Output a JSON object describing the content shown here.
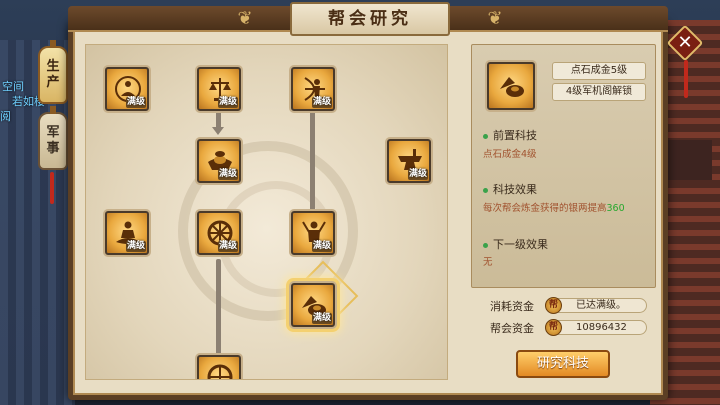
{
  "window": {
    "title": "帮会研究",
    "close_label": "✕"
  },
  "side_tabs": [
    {
      "label_top": "生",
      "label_bottom": "产"
    },
    {
      "label_top": "军",
      "label_bottom": "事"
    }
  ],
  "background_text": [
    "空间",
    "若如楼",
    "阅"
  ],
  "tree": {
    "nodes": [
      {
        "icon": "meditate-icon",
        "tag": "满级"
      },
      {
        "icon": "scale-icon",
        "tag": "满级"
      },
      {
        "icon": "archer-icon",
        "tag": "满级"
      },
      {
        "icon": "gold-ingot-icon",
        "tag": "满级"
      },
      {
        "icon": "anvil-icon",
        "tag": "满级"
      },
      {
        "icon": "lotus-meditate-icon",
        "tag": "满级"
      },
      {
        "icon": "wheel-icon",
        "tag": "满级"
      },
      {
        "icon": "warrior-icon",
        "tag": "满级"
      },
      {
        "icon": "stone-gold-icon",
        "tag": "满级"
      },
      {
        "icon": "wheel-icon",
        "tag": ""
      }
    ]
  },
  "detail": {
    "icon": "stone-gold-icon",
    "name_level": "点石成金5级",
    "unlock": "4级军机阁解锁",
    "prereq_title": "前置科技",
    "prereq_value": "点石成金4级",
    "effect_title": "科技效果",
    "effect_text": "每次帮会炼金获得的银两提高",
    "effect_value": "360",
    "next_title": "下一级效果",
    "next_value": "无"
  },
  "costs": {
    "consume_label": "消耗资金",
    "consume_value": "已达满级。",
    "guild_label": "帮会资金",
    "guild_value": "10896432",
    "coin_glyph": "帮"
  },
  "research_button": "研究科技",
  "colors": {
    "accent_gold": "#e9a83e",
    "effect_highlight": "#27a82e",
    "text_brown": "#a1522e"
  }
}
